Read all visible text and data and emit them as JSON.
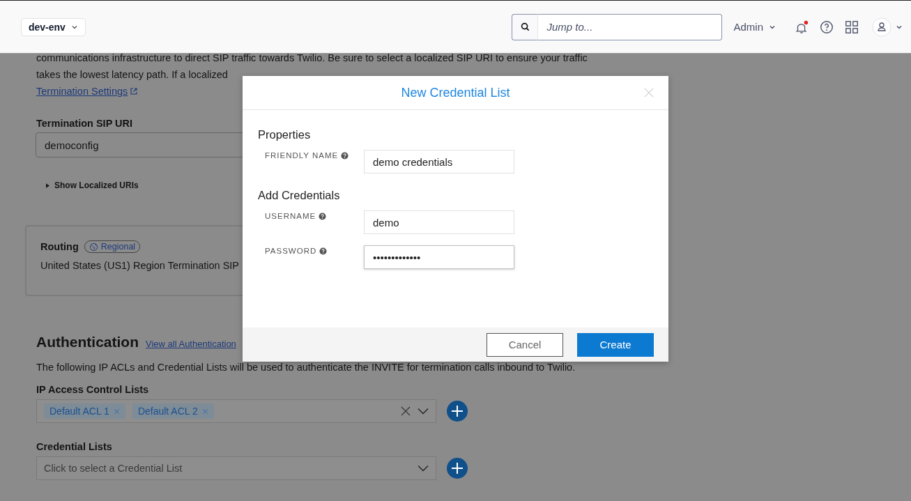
{
  "header": {
    "environment": "dev-env",
    "search": {
      "placeholder": "Jump to..."
    },
    "account_menu": "Admin",
    "notifications": {
      "unread": true
    }
  },
  "intro": {
    "line_1": "communications infrastructure to direct SIP traffic towards Twilio. Be sure to select a localized SIP URI to ensure your traffic",
    "line_2": "takes the lowest latency path. If a localized",
    "link_2": "Termination Settings"
  },
  "termination_uri": {
    "label": "Termination SIP URI",
    "value": "democonfig",
    "toggle": "Show Localized URIs",
    "expanded": false
  },
  "routing": {
    "label": "Routing",
    "badge": "Regional",
    "text": "United States (US1) Region Termination SIP"
  },
  "authentication": {
    "title": "Authentication",
    "link": "View all Authentication",
    "description": "The following IP ACLs and Credential Lists will be used to authenticate the INVITE for termination calls inbound to Twilio.",
    "ip_acl": {
      "label": "IP Access Control Lists",
      "tags": [
        "Default ACL 1",
        "Default ACL 2"
      ]
    },
    "credential_lists": {
      "label": "Credential Lists",
      "placeholder": "Click to select a Credential List"
    }
  },
  "modal": {
    "title": "New Credential List",
    "sections": [
      {
        "title": "Properties",
        "fields": [
          {
            "label": "FRIENDLY NAME",
            "value": "demo credentials",
            "focused": false
          }
        ]
      },
      {
        "title": "Add Credentials",
        "fields": [
          {
            "label": "USERNAME",
            "value": "demo",
            "focused": false
          },
          {
            "label": "PASSWORD",
            "value": "•••••••••••••",
            "focused": true
          }
        ]
      }
    ],
    "buttons": [
      {
        "label": "Cancel",
        "kind": "secondary"
      },
      {
        "label": "Create",
        "kind": "primary"
      }
    ]
  }
}
